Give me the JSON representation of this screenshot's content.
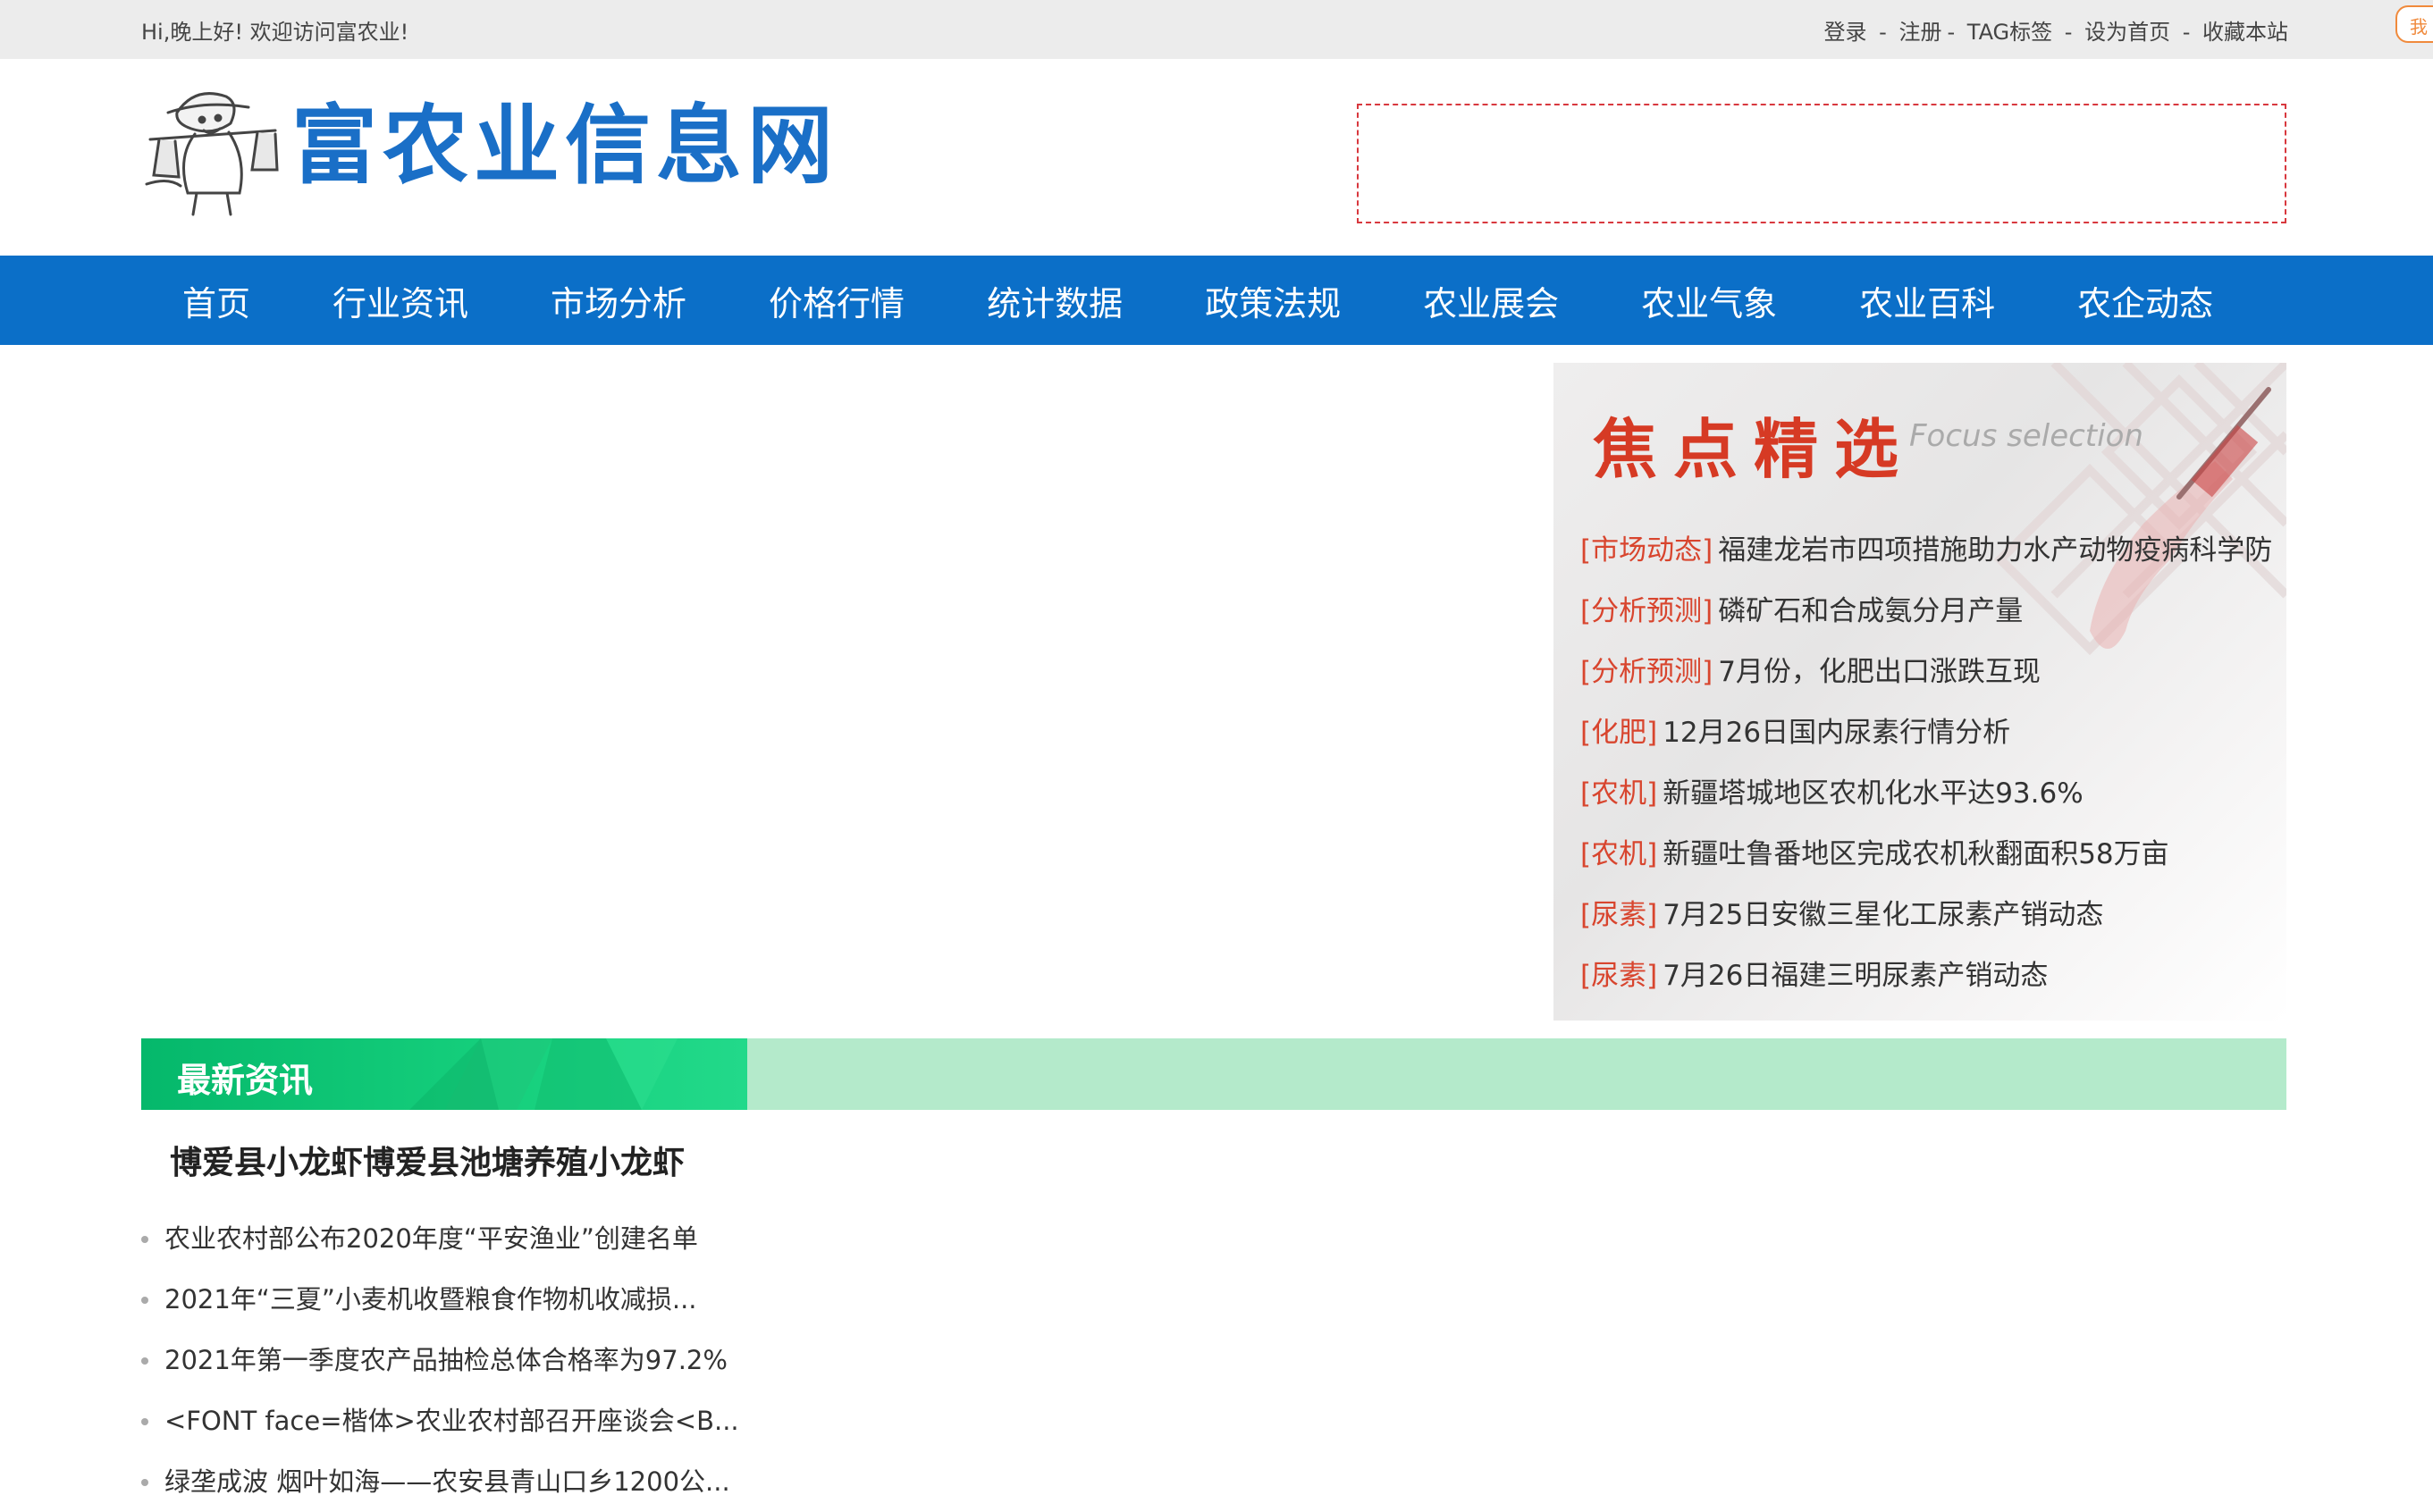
{
  "topbar": {
    "greeting": "Hi,晚上好!   欢迎访问富农业!",
    "links": [
      "登录",
      "注册",
      "TAG标签",
      "设为首页",
      "收藏本站"
    ],
    "separators": [
      " - ",
      "- ",
      " - ",
      " - "
    ],
    "corner_text": "我"
  },
  "logo": {
    "text": "富农业信息网",
    "icon": "farmer-mascot-icon"
  },
  "nav": {
    "items": [
      "首页",
      "行业资讯",
      "市场分析",
      "价格行情",
      "统计数据",
      "政策法规",
      "农业展会",
      "农业气象",
      "农业百科",
      "农企动态"
    ]
  },
  "focus": {
    "title": "焦点精选",
    "subtitle": "Focus selection",
    "items": [
      {
        "category": "[市场动态]",
        "title": "福建龙岩市四项措施助力水产动物疫病科学防"
      },
      {
        "category": "[分析预测]",
        "title": "磷矿石和合成氨分月产量"
      },
      {
        "category": "[分析预测]",
        "title": "7月份，化肥出口涨跌互现"
      },
      {
        "category": "[化肥]",
        "title": "12月26日国内尿素行情分析"
      },
      {
        "category": "[农机]",
        "title": "新疆塔城地区农机化水平达93.6%"
      },
      {
        "category": "[农机]",
        "title": "新疆吐鲁番地区完成农机秋翻面积58万亩"
      },
      {
        "category": "[尿素]",
        "title": "7月25日安徽三星化工尿素产销动态"
      },
      {
        "category": "[尿素]",
        "title": "7月26日福建三明尿素产销动态"
      }
    ]
  },
  "latest": {
    "label": "最新资讯",
    "headline": "博爱县小龙虾博爱县池塘养殖小龙虾",
    "items": [
      "农业农村部公布2020年度“平安渔业”创建名单",
      "2021年“三夏”小麦机收暨粮食作物机收减损...",
      "2021年第一季度农产品抽检总体合格率为97.2%",
      "<FONT face=楷体>农业农村部召开座谈会<B...",
      "绿垄成波 烟叶如海——农安县青山口乡1200公..."
    ]
  },
  "colors": {
    "nav_bg": "#0b6fc8",
    "accent_red": "#d8452e",
    "green": "#05b86b",
    "green_light": "#b4eacb",
    "logo_blue": "#1a6fc7"
  }
}
